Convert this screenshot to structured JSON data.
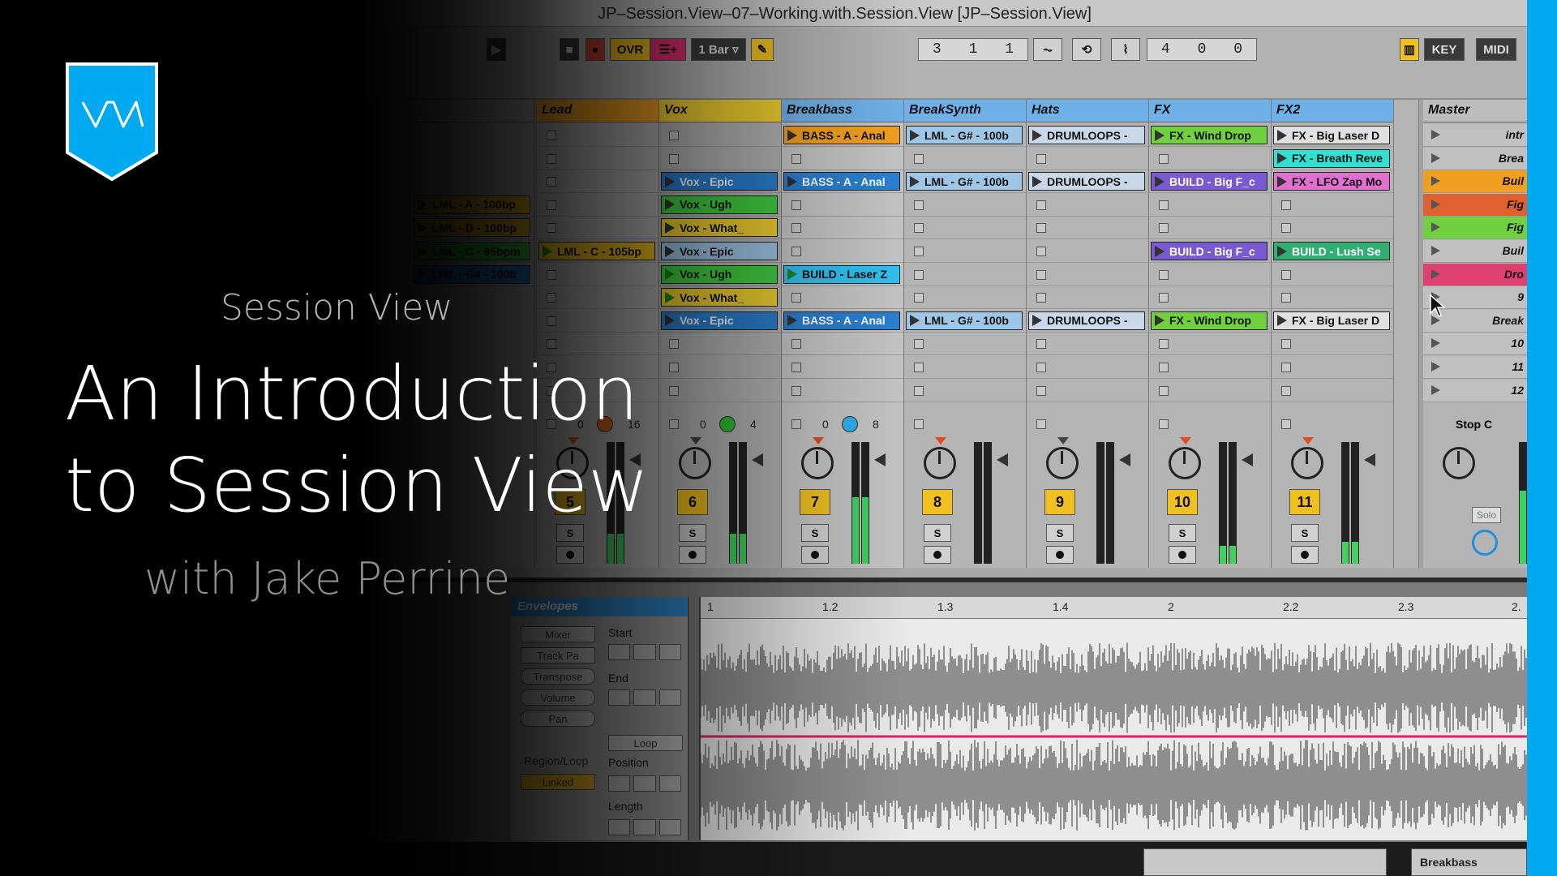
{
  "window": {
    "title": "JP–Session.View–07–Working.with.Session.View  [JP–Session.View]"
  },
  "toolbar": {
    "ovr": "OVR",
    "quantize": "1 Bar",
    "position": [
      "3",
      "1",
      "1"
    ],
    "loop_end": [
      "4",
      "0",
      "0"
    ],
    "key": "KEY",
    "midi": "MIDI"
  },
  "tracks": [
    {
      "name": "Lead",
      "color": "#f0a020",
      "number": "5",
      "left_num": "0",
      "right_num": "16",
      "knob": "#e06020",
      "clips": [
        {
          "row": 5,
          "name": "LML - C - 105bp",
          "color": "#f0c020",
          "playing": true
        }
      ]
    },
    {
      "name": "Vox",
      "color": "#f0d030",
      "number": "6",
      "left_num": "0",
      "right_num": "4",
      "knob": "#30c030",
      "clips": [
        {
          "row": 2,
          "name": "Vox - Epic",
          "color": "#2a80d0"
        },
        {
          "row": 3,
          "name": "Vox - Ugh",
          "color": "#40d040"
        },
        {
          "row": 4,
          "name": "Vox - What_",
          "color": "#f0d030"
        },
        {
          "row": 5,
          "name": "Vox - Epic",
          "color": "#9ec6e6"
        },
        {
          "row": 6,
          "name": "Vox - Ugh",
          "color": "#40d040",
          "playing": true
        },
        {
          "row": 7,
          "name": "Vox - What_",
          "color": "#f0d030",
          "playing": true
        },
        {
          "row": 8,
          "name": "Vox - Epic",
          "color": "#2a80d0"
        }
      ]
    },
    {
      "name": "Breakbass",
      "color": "#6fb0e8",
      "number": "7",
      "left_num": "0",
      "right_num": "8",
      "knob": "#30b0f0",
      "clips": [
        {
          "row": 0,
          "name": "BASS - A - Anal",
          "color": "#f0a020"
        },
        {
          "row": 2,
          "name": "BASS - A - Anal",
          "color": "#2a80d0"
        },
        {
          "row": 6,
          "name": "BUILD - Laser Z",
          "color": "#30c0f0",
          "playing": true
        },
        {
          "row": 8,
          "name": "BASS - A - Anal",
          "color": "#2a80d0"
        }
      ]
    },
    {
      "name": "BreakSynth",
      "color": "#6fb0e8",
      "number": "8",
      "left_num": "",
      "right_num": "",
      "knob": "",
      "clips": [
        {
          "row": 0,
          "name": "LML - G# - 100b",
          "color": "#9ec6e6"
        },
        {
          "row": 2,
          "name": "LML - G# - 100b",
          "color": "#9ec6e6"
        },
        {
          "row": 8,
          "name": "LML - G# - 100b",
          "color": "#9ec6e6"
        }
      ]
    },
    {
      "name": "Hats",
      "color": "#6fb0e8",
      "number": "9",
      "left_num": "",
      "right_num": "",
      "knob": "",
      "clips": [
        {
          "row": 0,
          "name": "DRUMLOOPS -",
          "color": "#c8d8e8"
        },
        {
          "row": 2,
          "name": "DRUMLOOPS -",
          "color": "#c8d8e8"
        },
        {
          "row": 8,
          "name": "DRUMLOOPS -",
          "color": "#c8d8e8"
        }
      ]
    },
    {
      "name": "FX",
      "color": "#6fb0e8",
      "number": "10",
      "left_num": "",
      "right_num": "",
      "knob": "",
      "clips": [
        {
          "row": 0,
          "name": "FX - Wind Drop",
          "color": "#70d040"
        },
        {
          "row": 2,
          "name": "BUILD - Big F_c",
          "color": "#7a5ad0"
        },
        {
          "row": 5,
          "name": "BUILD - Big F_c",
          "color": "#7a5ad0"
        },
        {
          "row": 8,
          "name": "FX - Wind Drop",
          "color": "#70d040"
        }
      ]
    },
    {
      "name": "FX2",
      "color": "#6fb0e8",
      "number": "11",
      "left_num": "",
      "right_num": "",
      "knob": "",
      "clips": [
        {
          "row": 0,
          "name": "FX - Big Laser D",
          "color": "#e0e0e0"
        },
        {
          "row": 1,
          "name": "FX - Breath Reve",
          "color": "#30e0d0"
        },
        {
          "row": 2,
          "name": "FX - LFO Zap Mo",
          "color": "#e070d0"
        },
        {
          "row": 5,
          "name": "BUILD - Lush Se",
          "color": "#30b070"
        },
        {
          "row": 8,
          "name": "FX - Big Laser D",
          "color": "#e0e0e0"
        }
      ]
    }
  ],
  "left_clips": [
    {
      "row": 3,
      "name": "LML - A - 100bp",
      "color": "#f0c020"
    },
    {
      "row": 4,
      "name": "LML - D - 100bp",
      "color": "#f0c020"
    },
    {
      "row": 5,
      "name": "LML - C - 95bpm",
      "color": "#40d040"
    },
    {
      "row": 6,
      "name": "LML - G# - 100b",
      "color": "#2a80d0"
    }
  ],
  "master": {
    "name": "Master",
    "scenes": [
      {
        "label": "intr",
        "color": "#c0c0c0"
      },
      {
        "label": "Brea",
        "color": "#c0c0c0"
      },
      {
        "label": "Buil",
        "color": "#f0a020"
      },
      {
        "label": "Fig",
        "color": "#e06030"
      },
      {
        "label": "Fig",
        "color": "#70d040"
      },
      {
        "label": "Buil",
        "color": "#c0c0c0"
      },
      {
        "label": "Dro",
        "color": "#e04070"
      },
      {
        "label": "9",
        "color": "#c0c0c0"
      },
      {
        "label": "Break",
        "color": "#c0c0c0"
      },
      {
        "label": "10",
        "color": "#c0c0c0"
      },
      {
        "label": "11",
        "color": "#c0c0c0"
      },
      {
        "label": "12",
        "color": "#c0c0c0"
      }
    ],
    "stop_label": "Stop C",
    "solo_label": "Solo"
  },
  "clip_view": {
    "header": "Envelopes",
    "devices": [
      "Mixer",
      "Track Pa"
    ],
    "buttons": [
      "Transpose",
      "Volume",
      "Pan"
    ],
    "start_label": "Start",
    "end_label": "End",
    "loop_label": "Loop",
    "position_label": "Position",
    "length_label": "Length",
    "region_label": "Region/Loop",
    "linked_label": "Linked"
  },
  "ruler": [
    "1",
    "1.2",
    "1.3",
    "1.4",
    "2",
    "2.2",
    "2.3",
    "2."
  ],
  "bottom": {
    "track_name": "Breakbass"
  },
  "hero": {
    "kicker": "Session View",
    "title_line1": "An Introduction",
    "title_line2": "to Session View",
    "byline": "with Jake Perrine"
  },
  "colors": {
    "accent": "#00a9f0",
    "playing": "#1a8a1a"
  }
}
